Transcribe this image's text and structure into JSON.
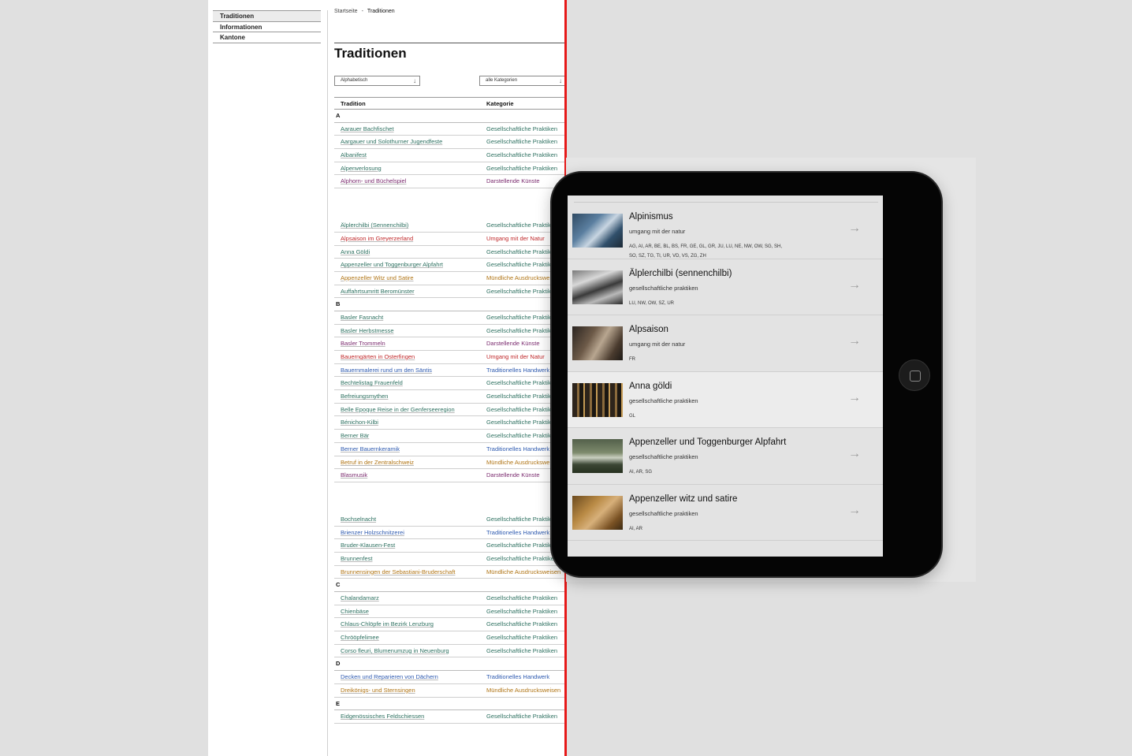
{
  "sidebar": {
    "items": [
      {
        "label": "Traditionen",
        "active": true
      },
      {
        "label": "Informationen",
        "active": false
      },
      {
        "label": "Kantone",
        "active": false
      }
    ]
  },
  "breadcrumb": {
    "home": "Startseite",
    "sep": "-",
    "current": "Traditionen"
  },
  "page_title": "Traditionen",
  "filters": {
    "sort": "Alphabetisch",
    "category": "alle Kategorien"
  },
  "table": {
    "headers": {
      "tradition": "Tradition",
      "kategorie": "Kategorie"
    },
    "categories": {
      "gesel": "Gesellschaftliche Praktiken",
      "darst": "Darstellende Künste",
      "umg": "Umgang mit der Natur",
      "mund": "Mündliche Ausdrucksweisen",
      "hand": "Traditionelles Handwerk"
    },
    "groups": [
      {
        "letter": "A",
        "rows": [
          {
            "name": "Aarauer Bachfischet",
            "cat": "gesel"
          },
          {
            "name": "Aargauer und Solothurner Jugendfeste",
            "cat": "gesel"
          },
          {
            "name": "Albanifest",
            "cat": "gesel"
          },
          {
            "name": "Alpenverlosung",
            "cat": "gesel"
          },
          {
            "name": "Alphorn- und Büchelspiel",
            "cat": "darst",
            "gap": true
          },
          {
            "name": "Älplerchilbi (Sennenchilbi)",
            "cat": "gesel"
          },
          {
            "name": "Alpsaison im Greyerzerland",
            "cat": "umg"
          },
          {
            "name": "Anna Göldi",
            "cat": "gesel"
          },
          {
            "name": "Appenzeller und Toggenburger Alpfahrt",
            "cat": "gesel"
          },
          {
            "name": "Appenzeller Witz und Satire",
            "cat": "mund"
          },
          {
            "name": "Auffahrtsumritt Beromünster",
            "cat": "gesel"
          }
        ]
      },
      {
        "letter": "B",
        "rows": [
          {
            "name": "Basler Fasnacht",
            "cat": "gesel"
          },
          {
            "name": "Basler Herbstmesse",
            "cat": "gesel"
          },
          {
            "name": "Basler Trommeln",
            "cat": "darst"
          },
          {
            "name": "Bauerngärten in Osterfingen",
            "cat": "umg"
          },
          {
            "name": "Bauernmalerei rund um den Säntis",
            "cat": "hand"
          },
          {
            "name": "Bechtelistag Frauenfeld",
            "cat": "gesel"
          },
          {
            "name": "Befreiungsmythen",
            "cat": "gesel"
          },
          {
            "name": "Belle Epoque Reise in der Genferseeregion",
            "cat": "gesel"
          },
          {
            "name": "Bénichon-Kilbi",
            "cat": "gesel"
          },
          {
            "name": "Berner Bär",
            "cat": "gesel"
          },
          {
            "name": "Berner Bauernkeramik",
            "cat": "hand"
          },
          {
            "name": "Betruf in der Zentralschweiz",
            "cat": "mund"
          },
          {
            "name": "Blasmusik",
            "cat": "darst",
            "gap": true
          },
          {
            "name": "Bochselnacht",
            "cat": "gesel"
          },
          {
            "name": "Brienzer Holzschnitzerei",
            "cat": "hand"
          },
          {
            "name": "Bruder-Klausen-Fest",
            "cat": "gesel"
          },
          {
            "name": "Brunnenfest",
            "cat": "gesel"
          },
          {
            "name": "Brunnensingen der Sebastiani-Bruderschaft",
            "cat": "mund"
          }
        ]
      },
      {
        "letter": "C",
        "rows": [
          {
            "name": "Chalandamarz",
            "cat": "gesel"
          },
          {
            "name": "Chienbäse",
            "cat": "gesel"
          },
          {
            "name": "Chlaus-Chlöpfe im Bezirk Lenzburg",
            "cat": "gesel"
          },
          {
            "name": "Chrööpfelimee",
            "cat": "gesel"
          },
          {
            "name": "Corso fleuri, Blumenumzug in Neuenburg",
            "cat": "gesel"
          }
        ]
      },
      {
        "letter": "D",
        "rows": [
          {
            "name": "Decken und Reparieren von Dächern",
            "cat": "hand"
          },
          {
            "name": "Dreikönigs- und Sternsingen",
            "cat": "mund"
          }
        ]
      },
      {
        "letter": "E",
        "rows": [
          {
            "name": "Eidgenössisches Feldschiessen",
            "cat": "gesel"
          }
        ]
      }
    ]
  },
  "tablet": {
    "items": [
      {
        "title": "Alpinismus",
        "cat": "umgang mit der natur",
        "cantons": [
          "AG, AI, AR, BE, BL, BS, FR, GE, GL, GR, JU, LU, NE, NW, OW, SG, SH,",
          "SO, SZ, TG, TI, UR, VD, VS, ZG, ZH"
        ],
        "thumb": "mountaineers",
        "highlight": false
      },
      {
        "title": "Älplerchilbi (sennenchilbi)",
        "cat": "gesellschaftliche praktiken",
        "cantons": [
          "LU, NW, OW, SZ, UR"
        ],
        "thumb": "crowd",
        "highlight": false
      },
      {
        "title": "Alpsaison",
        "cat": "umgang mit der natur",
        "cantons": [
          "FR"
        ],
        "thumb": "cheesemaking",
        "highlight": false
      },
      {
        "title": "Anna göldi",
        "cat": "gesellschaftliche praktiken",
        "cantons": [
          "GL"
        ],
        "thumb": "museum",
        "highlight": true
      },
      {
        "title": "Appenzeller und Toggenburger Alpfahrt",
        "cat": "gesellschaftliche praktiken",
        "cantons": [
          "AI, AR, SG"
        ],
        "thumb": "cows",
        "highlight": false
      },
      {
        "title": "Appenzeller witz und satire",
        "cat": "gesellschaftliche praktiken",
        "cantons": [
          "AI, AR"
        ],
        "thumb": "painting",
        "highlight": false
      }
    ],
    "arrow": "→"
  },
  "colors": {
    "gesel": "#2e7161",
    "darst": "#7a2a6e",
    "umg": "#c0282a",
    "mund": "#b07414",
    "hand": "#2f5bb0",
    "divider": "#e61919"
  }
}
